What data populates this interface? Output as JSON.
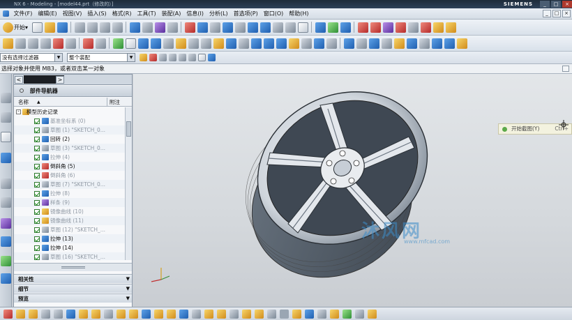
{
  "window": {
    "title": "NX 6 - Modeling - [model44.prt（修改的）]",
    "brand": "SIEMENS",
    "controls": [
      "_",
      "□",
      "×"
    ]
  },
  "menu": {
    "items": [
      "文件(F)",
      "编辑(E)",
      "视图(V)",
      "插入(S)",
      "格式(R)",
      "工具(T)",
      "装配(A)",
      "信息(I)",
      "分析(L)",
      "首选项(P)",
      "窗口(O)",
      "帮助(H)"
    ]
  },
  "toolbar": {
    "start_label": "开始",
    "start_arrow": "▾"
  },
  "filters": {
    "selection_filter": "没有选择过滤器",
    "assembly_scope": "整个装配"
  },
  "cue_line": "选择对象并使用 MB3，或者双击某一对象",
  "navigator": {
    "tab_left": "<",
    "tab_right": ">",
    "title": "部件导航器",
    "columns": {
      "name": "名称",
      "sort": "▲",
      "note": "附注"
    },
    "root": "模型历史记录",
    "items": [
      {
        "label": "基准坐标系 (0)",
        "dim": true
      },
      {
        "label": "草图 (1) \"SKETCH_0...",
        "dim": true
      },
      {
        "label": "回转 (2)",
        "dim": false
      },
      {
        "label": "草图 (3) \"SKETCH_0...",
        "dim": true
      },
      {
        "label": "拉伸 (4)",
        "dim": true
      },
      {
        "label": "倒斜角 (5)",
        "dim": false
      },
      {
        "label": "倒斜角 (6)",
        "dim": true
      },
      {
        "label": "草图 (7) \"SKETCH_0...",
        "dim": true
      },
      {
        "label": "拉伸 (8)",
        "dim": true
      },
      {
        "label": "样条 (9)",
        "dim": true
      },
      {
        "label": "镜像曲线 (10)",
        "dim": true
      },
      {
        "label": "镜像曲线 (11)",
        "dim": true
      },
      {
        "label": "草图 (12) \"SKETCH_...",
        "dim": true
      },
      {
        "label": "拉伸 (13)",
        "dim": false
      },
      {
        "label": "拉伸 (14)",
        "dim": false
      },
      {
        "label": "草图 (16) \"SKETCH_...",
        "dim": true
      }
    ],
    "sections": [
      "相关性",
      "细节",
      "预览"
    ]
  },
  "tooltip": {
    "label": "开始截图(Y)",
    "shortcut": "Ctrl+"
  },
  "watermark": {
    "main": "沐风网",
    "sub": "www.mfcad.com"
  },
  "colors": {
    "accent": "#1f5fb0",
    "titlebar": "#1d2b3a",
    "viewport": "#d5d9dd",
    "wheel": "#dfe3e8"
  }
}
